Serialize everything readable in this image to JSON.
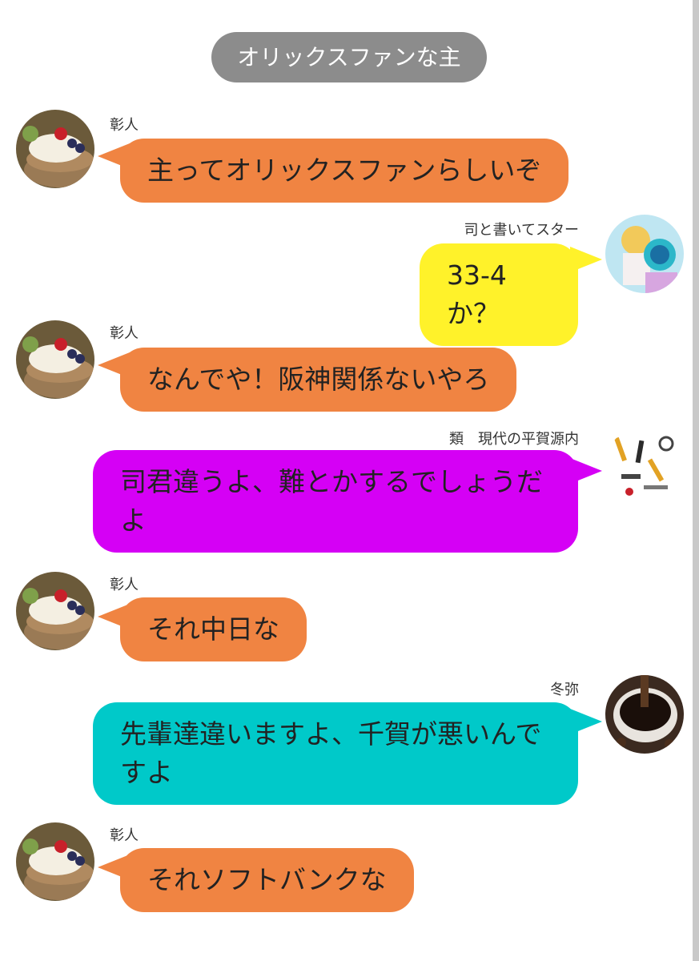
{
  "room": {
    "title": "オリックスファンな主"
  },
  "colors": {
    "akito": "#f08442",
    "tsukasa": "#fff22a",
    "rui": "#d500f5",
    "toya": "#00c9c9",
    "room_badge": "#8c8c8c"
  },
  "messages": [
    {
      "sender": "彰人",
      "text": "主ってオリックスファンらしいぞ",
      "side": "left",
      "avatar": "pancake-avatar"
    },
    {
      "sender": "司と書いてスター",
      "text": "33-4か？",
      "side": "right",
      "avatar": "idol-avatar"
    },
    {
      "sender": "彰人",
      "text": "なんでや！阪神関係ないやろ",
      "side": "left",
      "avatar": "pancake-avatar"
    },
    {
      "sender": "類　現代の平賀源内",
      "text": "司君違うよ、難とかするでしょうだよ",
      "side": "right",
      "avatar": "tools-avatar"
    },
    {
      "sender": "彰人",
      "text": "それ中日な",
      "side": "left",
      "avatar": "pancake-avatar"
    },
    {
      "sender": "冬弥",
      "text": "先輩達違いますよ、千賀が悪いんですよ",
      "side": "right",
      "avatar": "coffee-avatar"
    },
    {
      "sender": "彰人",
      "text": "それソフトバンクな",
      "side": "left",
      "avatar": "pancake-avatar"
    }
  ]
}
